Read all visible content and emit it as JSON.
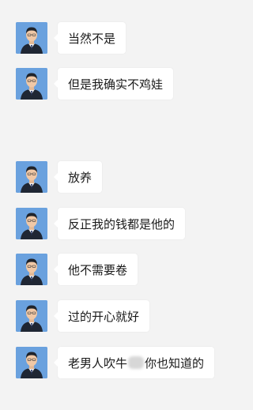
{
  "messages": [
    {
      "text": "当然不是"
    },
    {
      "text": "但是我确实不鸡娃"
    },
    {
      "text": "放养"
    },
    {
      "text": "反正我的钱都是他的"
    },
    {
      "text": "他不需要卷"
    },
    {
      "text": "过的开心就好"
    },
    {
      "text_before": "老男人吹牛",
      "text_after": "你也知道的"
    }
  ],
  "colors": {
    "background": "#f3f3f3",
    "bubble": "#ffffff",
    "text": "#1a1a1a",
    "avatar_bg": "#6aa1de"
  },
  "icons": {
    "avatar": "user-avatar-photo"
  }
}
